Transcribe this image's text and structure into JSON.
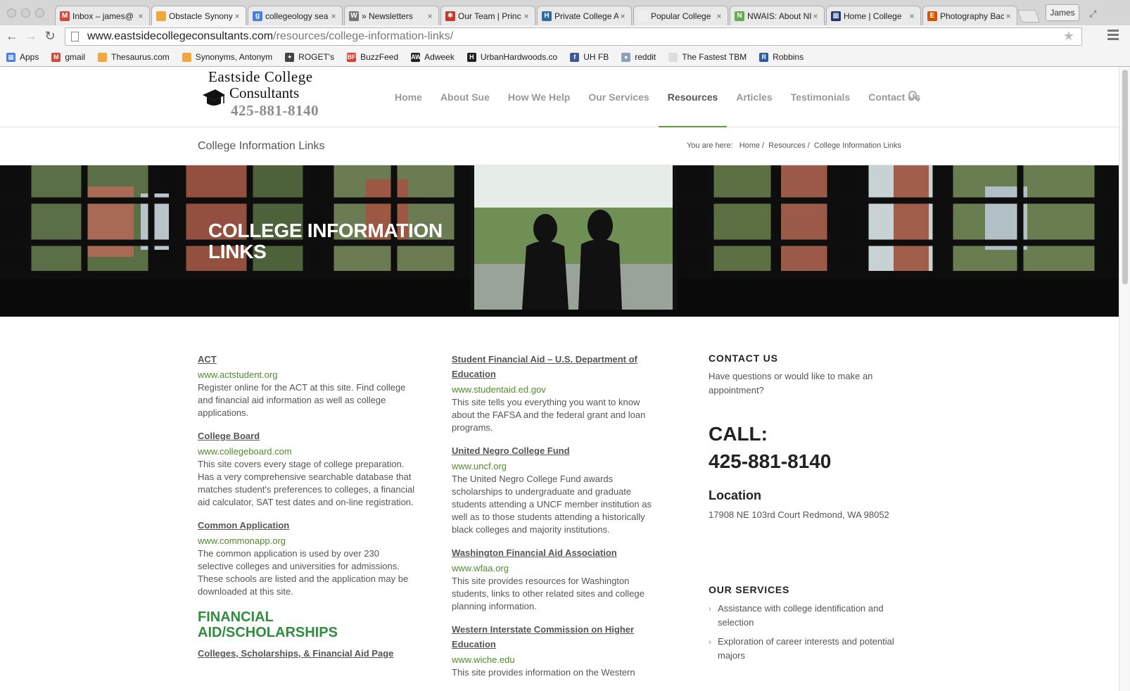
{
  "browser": {
    "tabs": [
      {
        "title": "Inbox – james@",
        "fav": "M",
        "color": "#d14836"
      },
      {
        "title": "Obstacle Synony",
        "fav": "",
        "color": "#f0a83c"
      },
      {
        "title": "collegeology sea",
        "fav": "g",
        "color": "#4a7fe0"
      },
      {
        "title": "» Newsletters",
        "fav": "W",
        "color": "#777777"
      },
      {
        "title": "Our Team | Princ",
        "fav": "✱",
        "color": "#c0392b"
      },
      {
        "title": "Private College A",
        "fav": "H",
        "color": "#2b6ea3"
      },
      {
        "title": "Popular College",
        "fav": "",
        "color": "#eeeeee"
      },
      {
        "title": "NWAIS: About NI",
        "fav": "N",
        "color": "#6aa84f"
      },
      {
        "title": "Home | College",
        "fav": "▦",
        "color": "#1f3a70"
      },
      {
        "title": "Photography Bac",
        "fav": "E",
        "color": "#d35400"
      }
    ],
    "profile": "James",
    "url_host": "www.eastsidecollegeconsultants.com",
    "url_path": "/resources/college-information-links/",
    "bookmarks": [
      {
        "label": "Apps",
        "fav": "▦",
        "color": "#4a7fe0"
      },
      {
        "label": "gmail",
        "fav": "M",
        "color": "#d14836"
      },
      {
        "label": "Thesaurus.com",
        "fav": "",
        "color": "#f0a83c"
      },
      {
        "label": "Synonyms, Antonym",
        "fav": "",
        "color": "#f0a83c"
      },
      {
        "label": "ROGET's",
        "fav": "✦",
        "color": "#444444"
      },
      {
        "label": "BuzzFeed",
        "fav": "BF",
        "color": "#e23b2e"
      },
      {
        "label": "Adweek",
        "fav": "AW",
        "color": "#222222"
      },
      {
        "label": "UrbanHardwoods.co",
        "fav": "H",
        "color": "#222222"
      },
      {
        "label": "UH FB",
        "fav": "f",
        "color": "#3b5998"
      },
      {
        "label": "reddit",
        "fav": "●",
        "color": "#8aa1b8"
      },
      {
        "label": "The Fastest TBM",
        "fav": "",
        "color": "#dddddd"
      },
      {
        "label": "Robbins",
        "fav": "R",
        "color": "#2e5aa8"
      }
    ]
  },
  "site": {
    "logo_line1": "Eastside College",
    "logo_line2": "Consultants",
    "logo_phone": "425-881-8140",
    "nav": [
      "Home",
      "About Sue",
      "How We Help",
      "Our Services",
      "Resources",
      "Articles",
      "Testimonials",
      "Contact Us"
    ],
    "current_nav": "Resources",
    "accent": "#5d9b3a"
  },
  "titlebar": {
    "title": "College Information Links",
    "you_are_here": "You are here:",
    "crumbs": [
      "Home",
      "Resources",
      "College Information Links"
    ]
  },
  "hero": {
    "title": "COLLEGE INFORMATION LINKS"
  },
  "col1": {
    "entries": [
      {
        "title": "ACT",
        "url": "www.actstudent.org",
        "desc": "Register online for the ACT at this site. Find college and financial aid information as well as college applications."
      },
      {
        "title": "College Board",
        "url": "www.collegeboard.com",
        "desc": "This site covers every stage of college preparation. Has a very comprehensive searchable database that matches student's preferences to colleges, a financial aid calculator, SAT test dates and on-line registration."
      },
      {
        "title": "Common Application",
        "url": "www.commonapp.org",
        "desc": "The common application is used by over 230 selective colleges and universities for admissions. These schools are listed and the application may be downloaded at this site."
      }
    ],
    "section_head": "FINANCIAL AID/SCHOLARSHIPS",
    "next_title": "Colleges, Scholarships, & Financial Aid Page"
  },
  "col2": {
    "entries": [
      {
        "title": "Student Financial Aid – U.S. Department of Education",
        "url": "www.studentaid.ed.gov",
        "desc": "This site tells you everything you want to know about the FAFSA and the federal grant and loan programs."
      },
      {
        "title": "United Negro College Fund",
        "url": "www.uncf.org",
        "desc": "The United Negro College Fund awards scholarships to undergraduate and graduate students attending a UNCF member institution as well as to those students attending a historically black colleges and majority institutions."
      },
      {
        "title": "Washington Financial Aid Association",
        "url": "www.wfaa.org",
        "desc": "This site provides resources for Washington students, links to other related sites and college planning information."
      },
      {
        "title": "Western Interstate Commission on Higher Education",
        "url": "www.wiche.edu",
        "desc": "This site provides information on the Western"
      }
    ]
  },
  "sidebar": {
    "contact_title": "CONTACT US",
    "contact_text": "Have questions or would like to make an appointment?",
    "call_label": "CALL:",
    "call_number": "425-881-8140",
    "location_title": "Location",
    "address": "17908 NE 103rd Court Redmond, WA 98052",
    "services_title": "OUR SERVICES",
    "services": [
      "Assistance with college identification and selection",
      "Exploration of career interests and potential majors"
    ]
  }
}
